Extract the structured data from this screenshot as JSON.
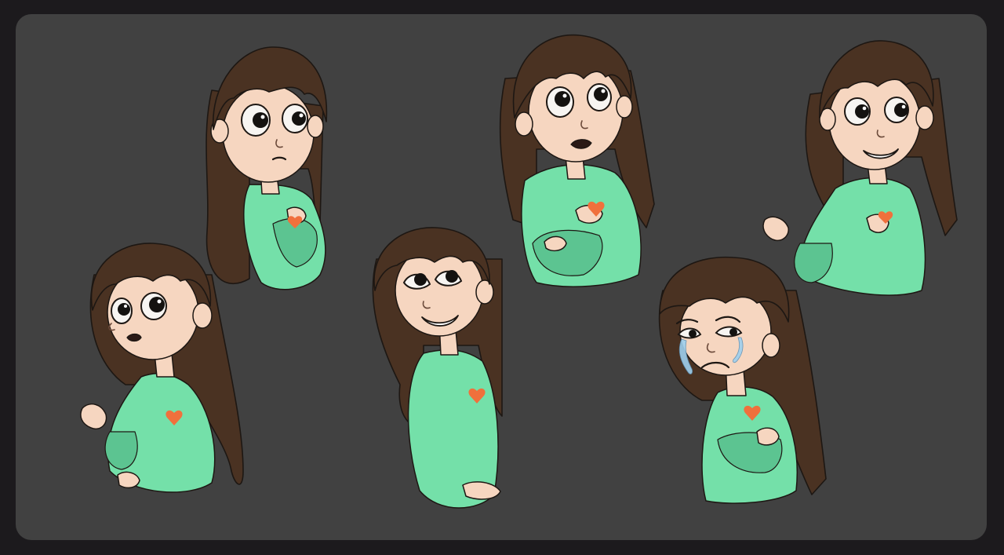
{
  "sheet": {
    "background_color": "#414141",
    "frame_color": "#1c1a1d"
  },
  "palette": {
    "hair": "#4a3222",
    "hair_shadow": "#3a2618",
    "skin": "#f6d6c0",
    "skin_shadow": "#e9b9a0",
    "shirt": "#74e0a9",
    "shirt_shadow": "#5cc491",
    "heart": "#f0703c",
    "line": "#1d1713",
    "eye_white": "#f7f5f2",
    "pupil": "#141210",
    "tear": "#9fd0ee"
  },
  "poses": [
    {
      "id": "worried-glance-right",
      "expression": "worried",
      "gaze": "right",
      "hand_on_heart": true,
      "crying": false
    },
    {
      "id": "anxious-look-up",
      "expression": "anxious",
      "gaze": "up-right",
      "hand_on_heart": true,
      "crying": false
    },
    {
      "id": "sly-grin",
      "expression": "sly-smile",
      "gaze": "right",
      "hand_on_heart": true,
      "crying": false
    },
    {
      "id": "startled-side",
      "expression": "startled",
      "gaze": "right",
      "hand_on_heart": false,
      "crying": false
    },
    {
      "id": "happy-look-up",
      "expression": "happy",
      "gaze": "up-right",
      "hand_on_heart": false,
      "crying": false
    },
    {
      "id": "crying",
      "expression": "crying",
      "gaze": "down-right",
      "hand_on_heart": true,
      "crying": true
    }
  ]
}
